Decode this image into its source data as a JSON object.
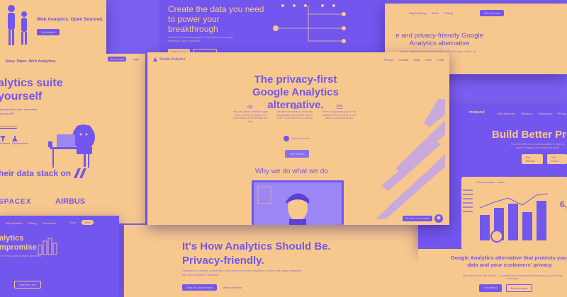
{
  "colors": {
    "purple": "#7356ee",
    "purple_dark": "#5b3fd8",
    "orange": "#f7c88e",
    "orange_deep": "#f0b06c",
    "ink": "#6a4fe0"
  },
  "top_left": {
    "headline": "Web Analytics. Open Sourced.",
    "button": "Get started"
  },
  "top_center": {
    "headline": "Create the data you need to power your breakthrough",
    "sub": "Unlock it and advanced analytics. Light from your own data warehouse, and on data lake.",
    "tab1": "Read docs",
    "tab2": "Community"
  },
  "top_right": {
    "nav": [
      "Why PostHog",
      "Docs",
      "Pricing"
    ],
    "cta": "Get free trial",
    "headline": "e and privacy-friendly Google Analytics alternative",
    "sub": "Simple, lightweight and privacy-friendly analytics for your website. No cookie banner needed."
  },
  "left_mid": {
    "top": "Easy. Open. Web Analytics.",
    "nav": [
      "Get Started",
      "Login"
    ],
    "headline1": "alytics suite",
    "headline2": "yourself",
    "sub": "your product data. arehouses, and on API.",
    "link": "book a Demo",
    "feature1": "Funnels",
    "feature2": "Experiments"
  },
  "left_stack": {
    "headline": "heir data stack on",
    "logo1": "SPACEX",
    "logo2": "AIRBUS"
  },
  "bottom_left": {
    "nav": [
      "Why Matomo",
      "Pricing",
      "Resources"
    ],
    "pill1": "Docs",
    "pill2": "Start",
    "headline1": "alytics",
    "headline2": "mpromise",
    "sub": "The best Google Analytics alternative.",
    "button": "Start free trial"
  },
  "main": {
    "brand": "Simple Analytics",
    "nav": [
      "Pricing",
      "Contact",
      "Blog",
      "Docs",
      "Login"
    ],
    "headline": "The privacy-first Google Analytics alternative.",
    "features": [
      {
        "text": "We show you the essentials: page views, referrers, top pages, and screen sizes. We do not track who visits."
      },
      {
        "text": "We don't use cookies or collect any personal data. So no cookie banners. GDPR, CCPA and PECR compliant."
      },
      {
        "text": "Want to analyze how you use the analytics? You don't need to, your data, be private and for you."
      }
    ],
    "toggle_label": "Show dark mode",
    "cta": "Get started",
    "subhead": "Why we do what we do",
    "chat": "Hi! How can we help?"
  },
  "right_card": {
    "brand": "mixpanel",
    "nav": [
      "Why Mixpanel",
      "Solutions",
      "Resources",
      "Pricing"
    ],
    "headline": "Build Better Pro",
    "sub": "Powerful, self-serve product analytics to help you convert, engage, and retain more users.",
    "btn1": "Get started",
    "btn2": "Get Demo",
    "tab": "Product metrics — Video",
    "metric": "6,"
  },
  "bottom_center": {
    "headline1": "It's How Analytics Should Be.",
    "headline2": "Privacy-friendly.",
    "sub": "Plausible is a simple, cookie-free, and open source web analytics solution that easily integrates into your website or backend.",
    "btn1": "Start 30-day free trial",
    "btn2": "View live demo"
  },
  "bottom_right": {
    "headline": "Google Analytics alternative that protects your data and your customers' privacy",
    "sub": "Take back control with Fathom — a beautiful and simple platform that gives you 100% data ownership.",
    "btn1": "Get started",
    "btn2": "Book a demo"
  }
}
